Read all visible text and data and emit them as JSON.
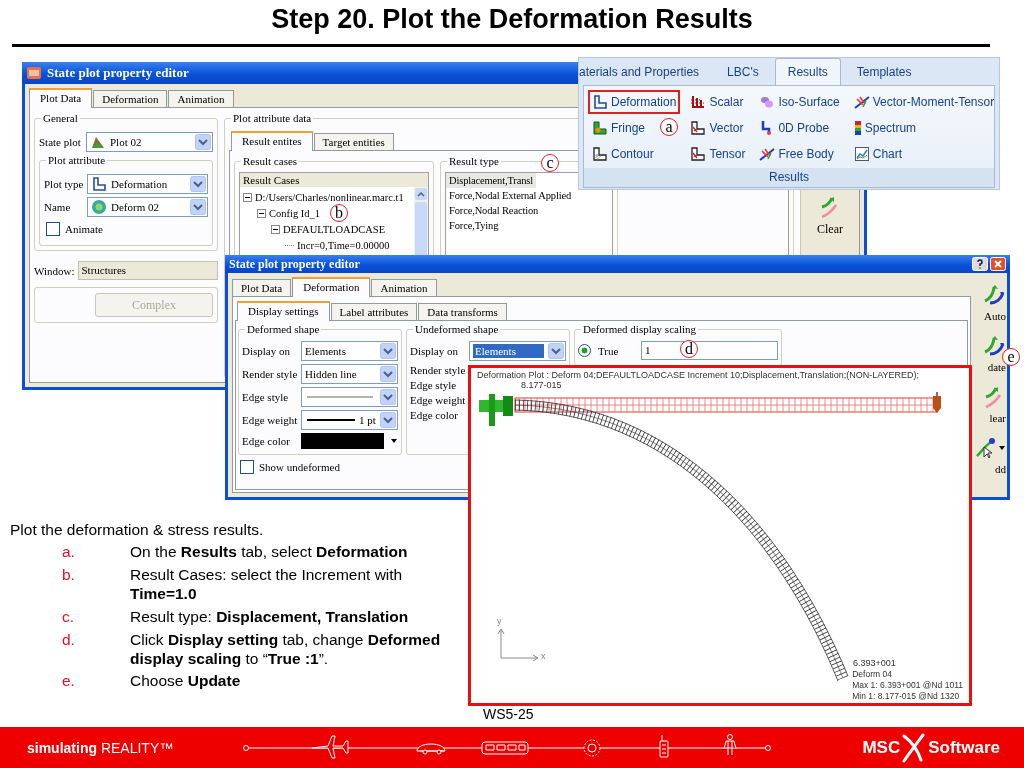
{
  "slide": {
    "title": "Step 20. Plot the Deformation Results",
    "page_number": "WS5-25"
  },
  "back_window": {
    "title": "State plot property editor",
    "tabs": [
      {
        "label": "Plot Data",
        "selected": true
      },
      {
        "label": "Deformation",
        "selected": false
      },
      {
        "label": "Animation",
        "selected": false
      }
    ],
    "general": {
      "legend": "General",
      "label": "State plot",
      "value": "Plot 02"
    },
    "plot_attribute": {
      "legend": "Plot attribute",
      "fields": [
        {
          "label": "Plot type",
          "value": "Deformation",
          "kind": "bracket"
        },
        {
          "label": "Name",
          "value": "Deform 02",
          "kind": "circle"
        }
      ],
      "animate": {
        "label": "Animate",
        "checked": false
      }
    },
    "window_field": {
      "label": "Window:",
      "value": "Structures"
    },
    "complex_button": {
      "label": "Complex",
      "disabled": true
    },
    "data_panel": {
      "legend": "Plot attribute data",
      "tabs": [
        {
          "label": "Result entites",
          "selected": true
        },
        {
          "label": "Target entities",
          "selected": false
        }
      ],
      "result_cases": {
        "legend": "Result cases",
        "header": "Result Cases",
        "tree": [
          {
            "label": "D:/Users/Charles/nonlinear.marc.t1",
            "expanded": true,
            "children": [
              {
                "label": "Config Id_1",
                "expanded": true,
                "children": [
                  {
                    "label": "DEFAULTLOADCASE",
                    "expanded": true,
                    "children": [
                      {
                        "label": "Incr=0,Time=0.00000"
                      }
                    ]
                  }
                ]
              }
            ]
          }
        ]
      },
      "result_type": {
        "legend": "Result type",
        "items": [
          {
            "label": "Displacement,Transl",
            "selected": true
          },
          {
            "label": "Force,Nodal External Applied",
            "selected": false
          },
          {
            "label": "Force,Nodal Reaction",
            "selected": false
          },
          {
            "label": "Force,Tying",
            "selected": false
          }
        ]
      }
    },
    "toolbar": [
      {
        "label": "Clear"
      }
    ]
  },
  "ribbon": {
    "tabs": [
      {
        "label": "aterials and Properties",
        "selected": false
      },
      {
        "label": "LBC's",
        "selected": false
      },
      {
        "label": "Results",
        "selected": true
      },
      {
        "label": "Templates",
        "selected": false
      }
    ],
    "items": [
      {
        "label": "Deformation",
        "kind": "deformation",
        "highlighted": true
      },
      {
        "label": "Scalar",
        "kind": "scalar",
        "highlighted": false
      },
      {
        "label": "Iso-Surface",
        "kind": "iso",
        "highlighted": false
      },
      {
        "label": "Vector-Moment-Tensor",
        "kind": "arrows",
        "highlighted": false
      },
      {
        "label": "Fringe",
        "kind": "fringe",
        "highlighted": false
      },
      {
        "label": "Vector",
        "kind": "vector",
        "highlighted": false
      },
      {
        "label": "0D Probe",
        "kind": "probe",
        "highlighted": false
      },
      {
        "label": "Spectrum",
        "kind": "spectrum",
        "highlighted": false
      },
      {
        "label": "Contour",
        "kind": "contour",
        "highlighted": false
      },
      {
        "label": "Tensor",
        "kind": "vector",
        "highlighted": false
      },
      {
        "label": "Free Body",
        "kind": "arrows",
        "highlighted": false
      },
      {
        "label": "Chart",
        "kind": "chart",
        "highlighted": false
      }
    ],
    "group_label": "Results"
  },
  "front_window": {
    "title": "State plot property editor",
    "tabs": [
      {
        "label": "Plot Data",
        "selected": false
      },
      {
        "label": "Deformation",
        "selected": true
      },
      {
        "label": "Animation",
        "selected": false
      }
    ],
    "subtabs": [
      {
        "label": "Display settings",
        "selected": true
      },
      {
        "label": "Label attributes",
        "selected": false
      },
      {
        "label": "Data transforms",
        "selected": false
      }
    ],
    "deformed_shape": {
      "legend": "Deformed shape",
      "rows": [
        {
          "label": "Display on",
          "kind": "select",
          "value": "Elements",
          "selected": false
        },
        {
          "label": "Render style",
          "kind": "select",
          "value": "Hidden line",
          "selected": false
        },
        {
          "label": "Edge style",
          "kind": "line_style"
        },
        {
          "label": "Edge weight",
          "kind": "line_weight",
          "value": "1 pt"
        },
        {
          "label": "Edge color",
          "kind": "color",
          "color": "#000000"
        }
      ]
    },
    "undeformed_shape": {
      "legend": "Undeformed shape",
      "rows": [
        {
          "label": "Display on",
          "kind": "select",
          "value": "Elements",
          "selected": true
        },
        {
          "label": "Render style"
        },
        {
          "label": "Edge style"
        },
        {
          "label": "Edge weight"
        },
        {
          "label": "Edge color"
        }
      ]
    },
    "scaling": {
      "legend": "Deformed display scaling",
      "option": {
        "label": "True",
        "selected": true
      },
      "value": "1"
    },
    "show_undeformed": {
      "label": "Show undeformed",
      "checked": false
    },
    "toolbar": [
      {
        "label": "Auto",
        "dropdown": false
      },
      {
        "label": "date",
        "dropdown": false
      },
      {
        "label": "lear",
        "dropdown": false
      },
      {
        "label": "dd",
        "dropdown": true
      }
    ]
  },
  "plot": {
    "title": "Deformation Plot : Deform 04;DEFAULTLOADCASE Increment 10;Displacement,Translation;(NON-LAYERED);",
    "min_label": "8.177-015",
    "max_label": "6.393+001",
    "legend": [
      "Deform 04",
      "Max 1: 6.393+001 @Nd 1011",
      "Min 1: 8.177-015 @Nd 1320"
    ],
    "axis_x": "x",
    "axis_y": "y"
  },
  "instructions": {
    "intro": "Plot the deformation & stress results.",
    "steps": [
      {
        "marker": "a.",
        "text": "On the **Results** tab, select **Deformation**"
      },
      {
        "marker": "b.",
        "text": "Result Cases: select the Increment with **Time=1.0**"
      },
      {
        "marker": "c.",
        "text": "Result type: **Displacement, Translation**"
      },
      {
        "marker": "d.",
        "text": "Click **Display setting** tab, change **Deformed display scaling** to “**True :1**”."
      },
      {
        "marker": "e.",
        "text": "Choose **Update**"
      }
    ]
  },
  "callouts": [
    {
      "label": "a"
    },
    {
      "label": "b"
    },
    {
      "label": "c"
    },
    {
      "label": "d"
    },
    {
      "label": "e"
    }
  ],
  "footer": {
    "tagline": "**simulating** REALITY™",
    "logo_left": "MSC",
    "logo_right": "Software"
  }
}
